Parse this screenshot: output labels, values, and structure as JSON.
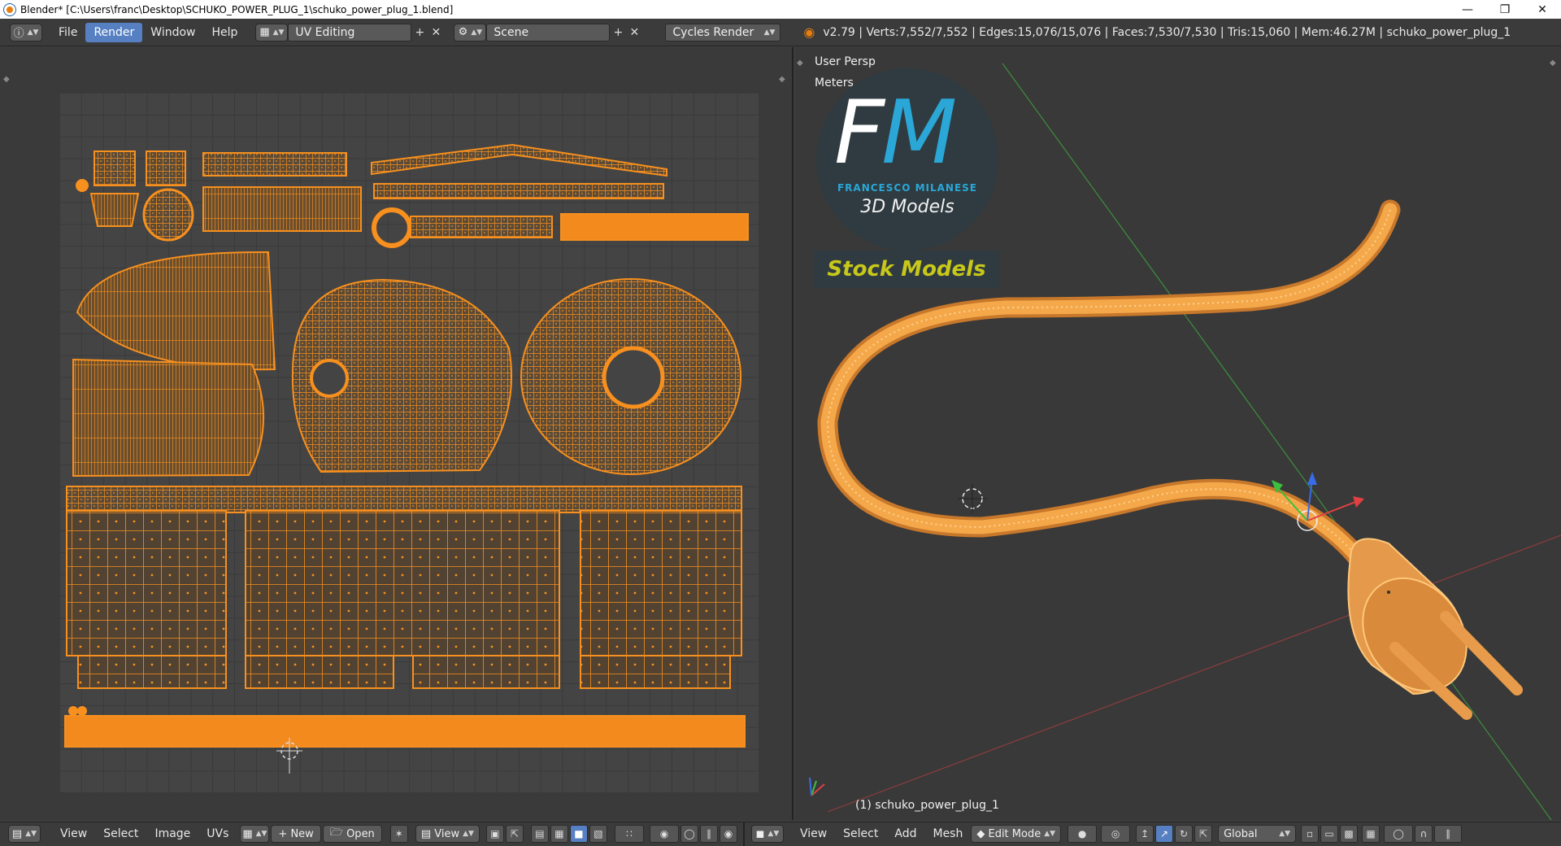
{
  "window": {
    "title": "Blender* [C:\\Users\\franc\\Desktop\\SCHUKO_POWER_PLUG_1\\schuko_power_plug_1.blend]",
    "minimize_icon": "minimize-icon",
    "maximize_icon": "restore-icon",
    "close_icon": "close-icon"
  },
  "infobar": {
    "editor_icon": "info-icon",
    "menus": [
      "File",
      "Render",
      "Window",
      "Help"
    ],
    "active_menu": "Render",
    "screen_layout": "UV Editing",
    "scene": "Scene",
    "render_engine": "Cycles Render",
    "stats": "v2.79 | Verts:7,552/7,552 | Edges:15,076/15,076 | Faces:7,530/7,530 | Tris:15,060 | Mem:46.27M | schuko_power_plug_1"
  },
  "viewport": {
    "view_name": "User Persp",
    "units": "Meters",
    "object_label": "(1) schuko_power_plug_1"
  },
  "logo": {
    "letters_f": "F",
    "letters_m": "M",
    "name": "FRANCESCO MILANESE",
    "subtitle": "3D Models",
    "stock": "Stock Models"
  },
  "uv_header": {
    "menus": [
      "View",
      "Select",
      "Image",
      "UVs"
    ],
    "new_label": "New",
    "open_label": "Open",
    "view_label": "View"
  },
  "viewport_header": {
    "menus": [
      "View",
      "Select",
      "Add",
      "Mesh"
    ],
    "mode": "Edit Mode",
    "orientation": "Global"
  },
  "colors": {
    "accent": "#5680c2",
    "uv_orange": "#f7901e",
    "mesh_orange": "#f4a84a",
    "logo_blue": "#2aa7d7",
    "stock_yellow": "#c8c81a"
  }
}
